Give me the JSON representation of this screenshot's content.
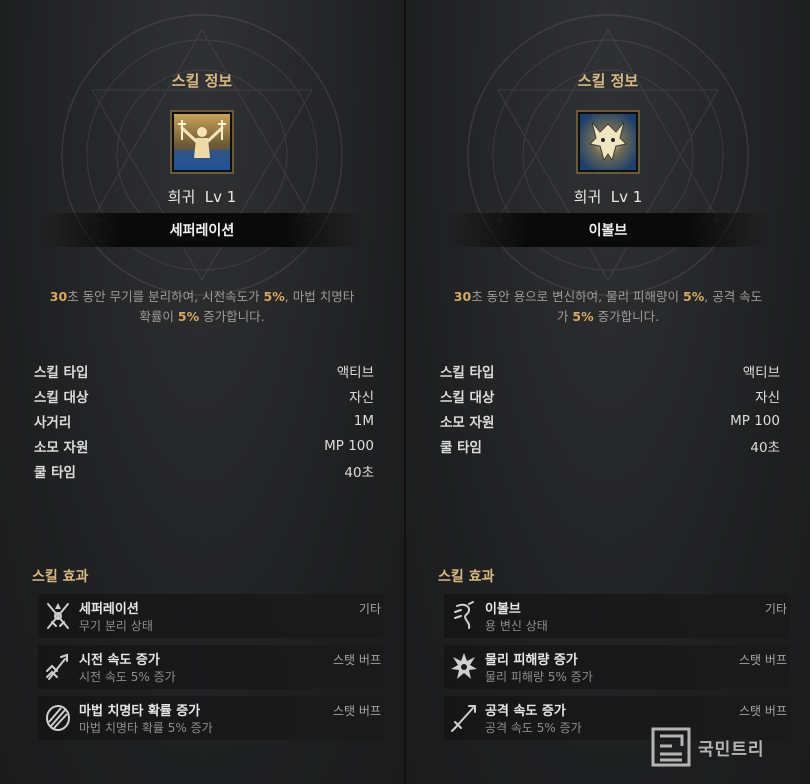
{
  "panels": [
    {
      "title": "스킬 정보",
      "icon": "separation-skill-icon",
      "grade": "희귀",
      "level": "Lv 1",
      "skill_name": "세퍼레이션",
      "desc_parts": [
        {
          "text": "30",
          "hl": true
        },
        {
          "text": "초 동안 무기를 분리하여, 시전속도가 ",
          "hl": false
        },
        {
          "text": "5%",
          "hl": true
        },
        {
          "text": ", 마법 치명타",
          "hl": false
        },
        {
          "br": true
        },
        {
          "text": "확률이 ",
          "hl": false
        },
        {
          "text": "5%",
          "hl": true
        },
        {
          "text": " 증가합니다.",
          "hl": false
        }
      ],
      "stats": [
        {
          "k": "스킬 타입",
          "v": "액티브"
        },
        {
          "k": "스킬 대상",
          "v": "자신"
        },
        {
          "k": "사거리",
          "v": "1M"
        },
        {
          "k": "소모 자원",
          "v": "MP 100"
        },
        {
          "k": "쿨 타임",
          "v": "40초"
        }
      ],
      "effects_title": "스킬 효과",
      "effects": [
        {
          "name": "세퍼레이션",
          "sub": "무기 분리 상태",
          "type": "기타",
          "icon": "crossed-blades-icon"
        },
        {
          "name": "시전 속도 증가",
          "sub": "시전 속도 5% 증가",
          "type": "스탯 버프",
          "icon": "staff-up-icon"
        },
        {
          "name": "마법 치명타 확률 증가",
          "sub": "마법 치명타 확률 5% 증가",
          "type": "스탯 버프",
          "icon": "magic-crit-icon"
        }
      ]
    },
    {
      "title": "스킬 정보",
      "icon": "dragon-skill-icon",
      "grade": "희귀",
      "level": "Lv 1",
      "skill_name": "이볼브",
      "desc_parts": [
        {
          "text": "30",
          "hl": true
        },
        {
          "text": "초 동안 용으로 변신하여, 물리 피해량이 ",
          "hl": false
        },
        {
          "text": "5%",
          "hl": true
        },
        {
          "text": ", 공격 속도",
          "hl": false
        },
        {
          "br": true
        },
        {
          "text": "가 ",
          "hl": false
        },
        {
          "text": "5%",
          "hl": true
        },
        {
          "text": " 증가합니다.",
          "hl": false
        }
      ],
      "stats": [
        {
          "k": "스킬 타입",
          "v": "액티브"
        },
        {
          "k": "스킬 대상",
          "v": "자신"
        },
        {
          "k": "소모 자원",
          "v": "MP 100"
        },
        {
          "k": "쿨 타임",
          "v": "40초"
        }
      ],
      "effects_title": "스킬 효과",
      "effects": [
        {
          "name": "이볼브",
          "sub": "용 변신 상태",
          "type": "기타",
          "icon": "dragon-head-icon"
        },
        {
          "name": "물리 피해량 증가",
          "sub": "물리 피해량 5% 증가",
          "type": "스탯 버프",
          "icon": "burst-icon"
        },
        {
          "name": "공격 속도 증가",
          "sub": "공격 속도 5% 증가",
          "type": "스탯 버프",
          "icon": "sword-up-icon"
        }
      ]
    }
  ],
  "watermark": "국민트리",
  "colors": {
    "accent": "#d7b883",
    "highlight": "#d8a962"
  }
}
